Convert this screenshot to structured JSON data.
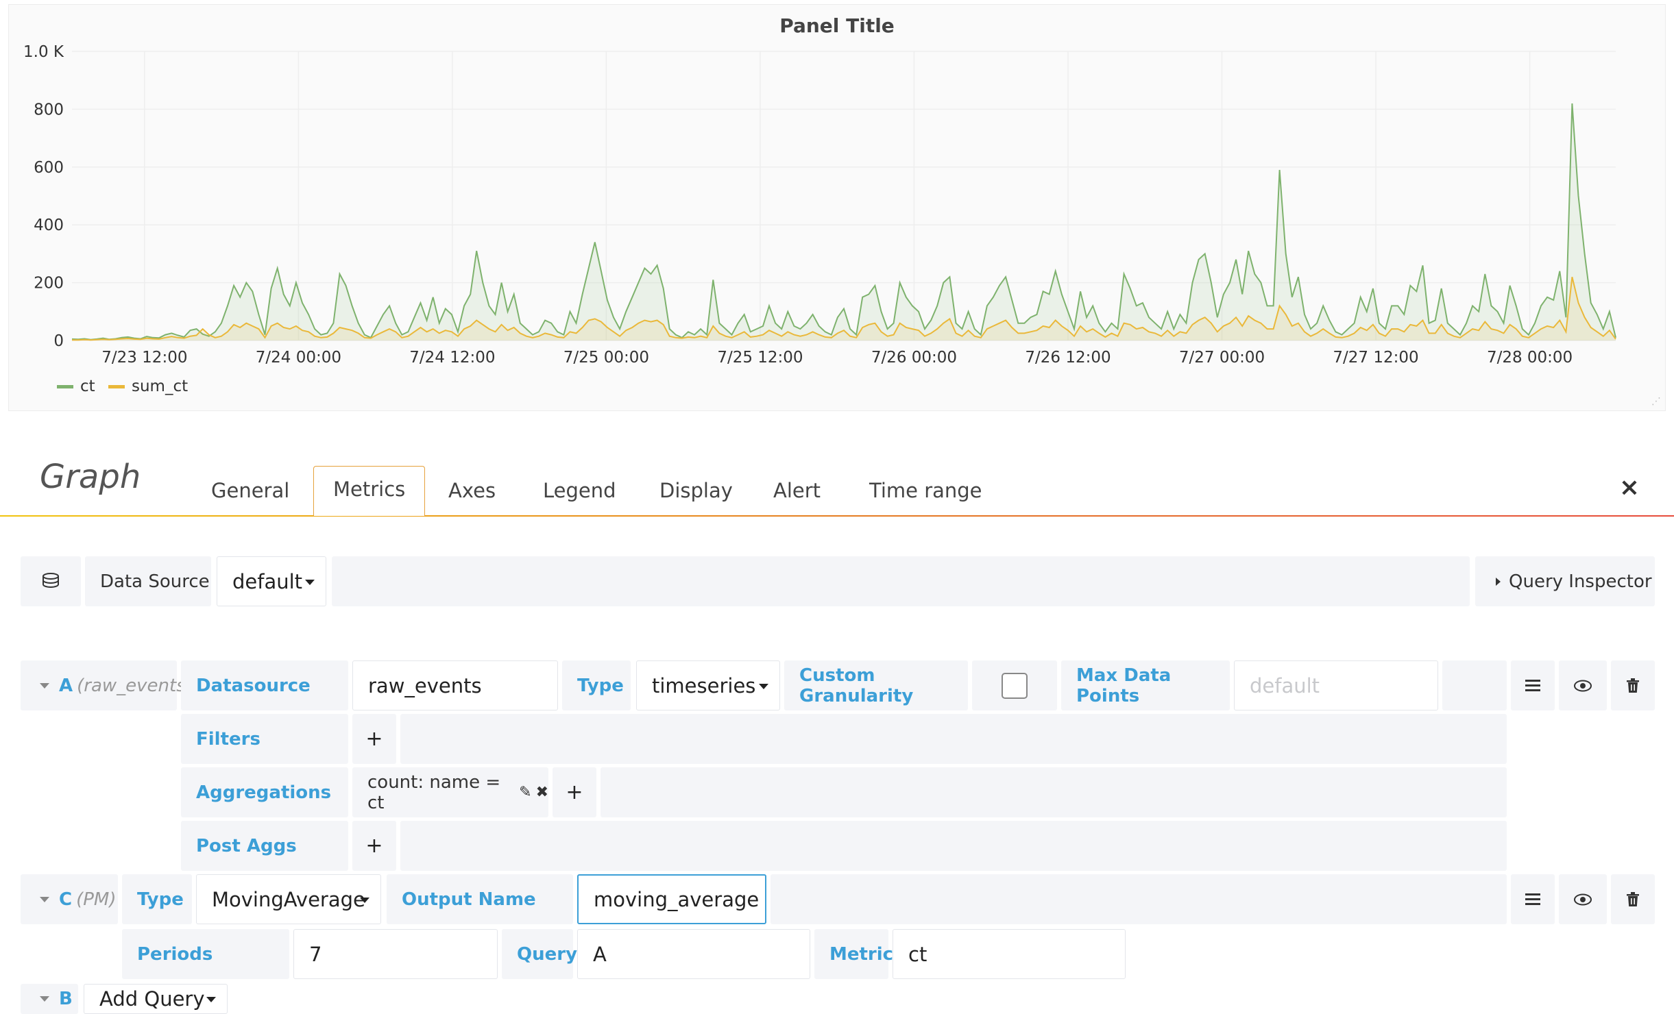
{
  "panel": {
    "title": "Panel Title",
    "legend": [
      {
        "name": "ct",
        "color": "#7eb26d"
      },
      {
        "name": "sum_ct",
        "color": "#eab839"
      }
    ]
  },
  "chart_data": {
    "type": "area",
    "title": "Panel Title",
    "y_ticks": [
      "1.0 K",
      "800",
      "600",
      "400",
      "200",
      "0"
    ],
    "x_ticks": [
      "7/23 12:00",
      "7/24 00:00",
      "7/24 12:00",
      "7/25 00:00",
      "7/25 12:00",
      "7/26 00:00",
      "7/26 12:00",
      "7/27 00:00",
      "7/27 12:00",
      "7/28 00:00"
    ],
    "ylim": [
      0,
      1000
    ],
    "grid": true,
    "legend_position": "bottom-left",
    "series": [
      {
        "name": "ct",
        "color": "#7eb26d",
        "values": [
          5,
          4,
          6,
          3,
          5,
          8,
          4,
          6,
          10,
          12,
          8,
          6,
          14,
          10,
          9,
          20,
          25,
          18,
          12,
          35,
          40,
          22,
          15,
          30,
          60,
          120,
          190,
          150,
          200,
          170,
          90,
          20,
          180,
          250,
          160,
          120,
          200,
          130,
          90,
          40,
          20,
          25,
          60,
          230,
          190,
          120,
          60,
          20,
          10,
          50,
          90,
          120,
          60,
          20,
          30,
          80,
          130,
          70,
          150,
          60,
          110,
          90,
          30,
          120,
          160,
          310,
          200,
          120,
          90,
          200,
          100,
          160,
          60,
          40,
          20,
          30,
          70,
          60,
          30,
          20,
          100,
          60,
          160,
          250,
          340,
          240,
          140,
          80,
          40,
          100,
          150,
          200,
          250,
          230,
          260,
          180,
          40,
          20,
          10,
          30,
          20,
          40,
          20,
          210,
          60,
          40,
          20,
          60,
          90,
          30,
          40,
          50,
          120,
          60,
          40,
          100,
          50,
          40,
          60,
          90,
          50,
          30,
          20,
          80,
          110,
          40,
          20,
          150,
          160,
          190,
          100,
          40,
          60,
          200,
          150,
          120,
          100,
          40,
          70,
          120,
          200,
          220,
          60,
          40,
          100,
          40,
          20,
          120,
          150,
          190,
          220,
          140,
          60,
          60,
          80,
          90,
          170,
          160,
          240,
          160,
          100,
          40,
          170,
          80,
          120,
          60,
          30,
          60,
          40,
          230,
          180,
          120,
          130,
          80,
          60,
          40,
          100,
          40,
          90,
          60,
          200,
          280,
          300,
          200,
          80,
          160,
          200,
          280,
          160,
          310,
          230,
          200,
          120,
          120,
          590,
          300,
          150,
          220,
          90,
          40,
          60,
          120,
          70,
          30,
          20,
          40,
          60,
          150,
          100,
          180,
          60,
          40,
          120,
          120,
          90,
          190,
          170,
          260,
          60,
          70,
          180,
          60,
          40,
          20,
          60,
          120,
          100,
          230,
          120,
          100,
          60,
          190,
          120,
          40,
          20,
          60,
          120,
          150,
          140,
          240,
          80,
          820,
          500,
          300,
          130,
          90,
          40,
          100,
          10
        ]
      },
      {
        "name": "sum_ct",
        "color": "#eab839",
        "values": [
          2,
          2,
          3,
          2,
          3,
          4,
          3,
          4,
          6,
          7,
          5,
          4,
          8,
          6,
          5,
          10,
          14,
          10,
          8,
          15,
          18,
          40,
          20,
          10,
          15,
          30,
          55,
          45,
          60,
          50,
          40,
          10,
          50,
          60,
          45,
          40,
          50,
          35,
          30,
          15,
          10,
          12,
          25,
          45,
          40,
          35,
          25,
          10,
          8,
          20,
          30,
          40,
          30,
          10,
          15,
          30,
          45,
          30,
          40,
          25,
          35,
          30,
          15,
          40,
          50,
          70,
          55,
          40,
          30,
          55,
          35,
          45,
          25,
          15,
          10,
          15,
          25,
          20,
          12,
          10,
          30,
          25,
          45,
          70,
          75,
          65,
          45,
          30,
          15,
          35,
          45,
          60,
          70,
          65,
          70,
          55,
          15,
          10,
          8,
          12,
          10,
          15,
          10,
          50,
          25,
          15,
          10,
          20,
          30,
          12,
          15,
          20,
          35,
          25,
          15,
          30,
          20,
          15,
          20,
          30,
          20,
          12,
          10,
          25,
          35,
          15,
          10,
          45,
          55,
          60,
          30,
          15,
          20,
          60,
          45,
          40,
          35,
          15,
          25,
          40,
          60,
          75,
          25,
          15,
          35,
          15,
          10,
          40,
          50,
          60,
          70,
          45,
          25,
          25,
          30,
          35,
          50,
          45,
          70,
          50,
          35,
          15,
          50,
          30,
          40,
          25,
          12,
          25,
          15,
          60,
          55,
          40,
          45,
          30,
          25,
          15,
          35,
          15,
          30,
          25,
          55,
          70,
          80,
          60,
          30,
          50,
          60,
          80,
          50,
          85,
          70,
          60,
          40,
          40,
          120,
          90,
          50,
          60,
          30,
          15,
          25,
          40,
          25,
          12,
          10,
          15,
          25,
          45,
          35,
          55,
          25,
          15,
          40,
          40,
          30,
          55,
          50,
          70,
          25,
          25,
          55,
          25,
          15,
          10,
          25,
          40,
          35,
          65,
          40,
          35,
          25,
          55,
          40,
          15,
          10,
          25,
          40,
          50,
          45,
          70,
          30,
          220,
          130,
          80,
          45,
          30,
          15,
          35,
          5
        ]
      }
    ]
  },
  "editor": {
    "title": "Graph",
    "tabs": [
      "General",
      "Metrics",
      "Axes",
      "Legend",
      "Display",
      "Alert",
      "Time range"
    ],
    "active_tab": "Metrics",
    "close_icon": "×"
  },
  "datasource_bar": {
    "label": "Data Source",
    "value": "default",
    "query_inspector": "Query Inspector"
  },
  "query_a": {
    "ref": "A",
    "ref_sub": "(raw_events)",
    "datasource_label": "Datasource",
    "datasource_value": "raw_events",
    "type_label": "Type",
    "type_value": "timeseries",
    "custom_granularity_label": "Custom Granularity",
    "max_data_points_label": "Max Data Points",
    "max_data_points_placeholder": "default",
    "filters_label": "Filters",
    "aggregations_label": "Aggregations",
    "aggregation_item": "count: name = ct",
    "post_aggs_label": "Post Aggs"
  },
  "query_c": {
    "ref": "C",
    "ref_sub": "(PM)",
    "type_label": "Type",
    "type_value": "MovingAverage",
    "output_name_label": "Output Name",
    "output_name_value": "moving_average",
    "periods_label": "Periods",
    "periods_value": "7",
    "query_label": "Query",
    "query_value": "A",
    "metric_label": "Metric",
    "metric_value": "ct"
  },
  "query_b": {
    "ref": "B",
    "add_query": "Add Query"
  }
}
